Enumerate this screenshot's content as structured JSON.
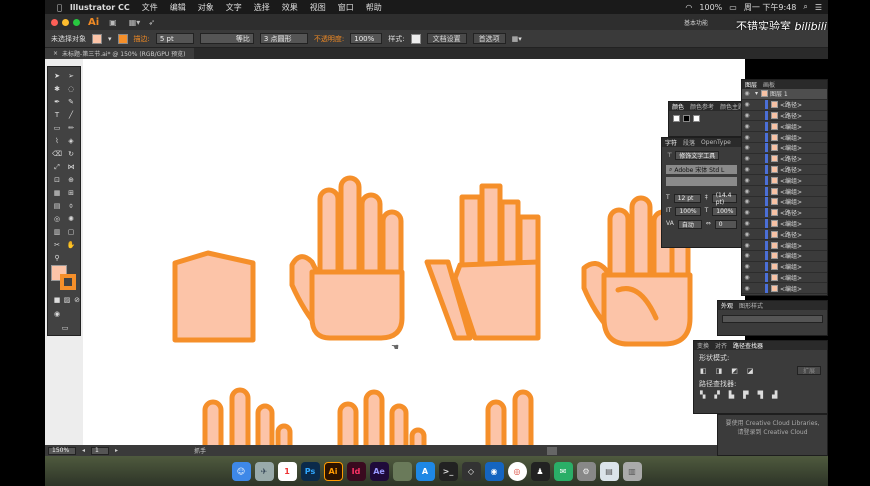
{
  "menubar": {
    "app_name": "Illustrator CC",
    "items": [
      "文件",
      "编辑",
      "对象",
      "文字",
      "选择",
      "效果",
      "视图",
      "窗口",
      "帮助"
    ],
    "status_percent": "100%",
    "clock": "周一 下午9:48"
  },
  "app_bar": {
    "logo": "Ai",
    "workspace": "基本功能"
  },
  "control_bar": {
    "no_selection": "未选择对象",
    "stroke_label": "描边:",
    "stroke_weight": "5 pt",
    "stroke_profile": "等比",
    "brush": "3 点圆形",
    "opacity_label": "不透明度:",
    "opacity_value": "100%",
    "style_label": "样式:",
    "doc_setup": "文档设置",
    "preferences": "首选项"
  },
  "doc_tab": {
    "title": "未标题-第三节.ai* @ 150% (RGB/GPU 预览)"
  },
  "status_bar": {
    "zoom": "150%",
    "page": "1",
    "tool_name": "抓手"
  },
  "layers_panel": {
    "tabs": [
      "图层",
      "画板"
    ],
    "top_layer": "图层 1",
    "rows": [
      "<路径>",
      "<路径>",
      "<编组>",
      "<编组>",
      "<编组>",
      "<路径>",
      "<路径>",
      "<编组>",
      "<编组>",
      "<编组>",
      "<路径>",
      "<编组>",
      "<路径>",
      "<编组>",
      "<编组>",
      "<编组>",
      "<编组>",
      "<编组>",
      "<编组>"
    ]
  },
  "color_panel": {
    "tabs": [
      "颜色",
      "颜色参考",
      "颜色主题"
    ]
  },
  "character_panel": {
    "tabs": [
      "字符",
      "段落",
      "OpenType"
    ],
    "touch_type": "修饰文字工具",
    "font_family": "Adobe 宋体 Std L",
    "font_size": "12 pt",
    "leading": "(14.4 pt)",
    "vscale": "100%",
    "hscale": "100%",
    "kerning": "自动",
    "tracking": "0"
  },
  "appearance_panel": {
    "tabs": [
      "外观",
      "图形样式"
    ]
  },
  "pathfinder_panel": {
    "tabs": [
      "变换",
      "对齐",
      "路径查找器"
    ],
    "shape_modes": "形状模式:",
    "expand": "扩展",
    "pathfinders": "路径查找器:"
  },
  "cc_libraries": {
    "line1": "要使用 Creative Cloud Libraries,",
    "line2": "请登录到 Creative Cloud"
  },
  "watermark": "不错实验室",
  "dock": {
    "icons": [
      "finder-icon",
      "launchpad-icon",
      "calendar-icon",
      "photoshop-icon",
      "illustrator-icon",
      "indesign-icon",
      "after-effects-icon",
      "photos-icon",
      "appstore-icon",
      "terminal-icon",
      "unity-icon",
      "qq-browser-icon",
      "chrome-icon",
      "qq-icon",
      "wechat-icon",
      "settings-icon",
      "documents-icon",
      "trash-icon"
    ],
    "calendar_day": "1",
    "ps_label": "Ps",
    "ai_label": "Ai",
    "id_label": "Id",
    "ae_label": "Ae"
  },
  "colors": {
    "fill": "#fcc4a8",
    "stroke": "#f58f2a",
    "panel_bg": "#3b3b3b",
    "accent": "#f08a24"
  }
}
